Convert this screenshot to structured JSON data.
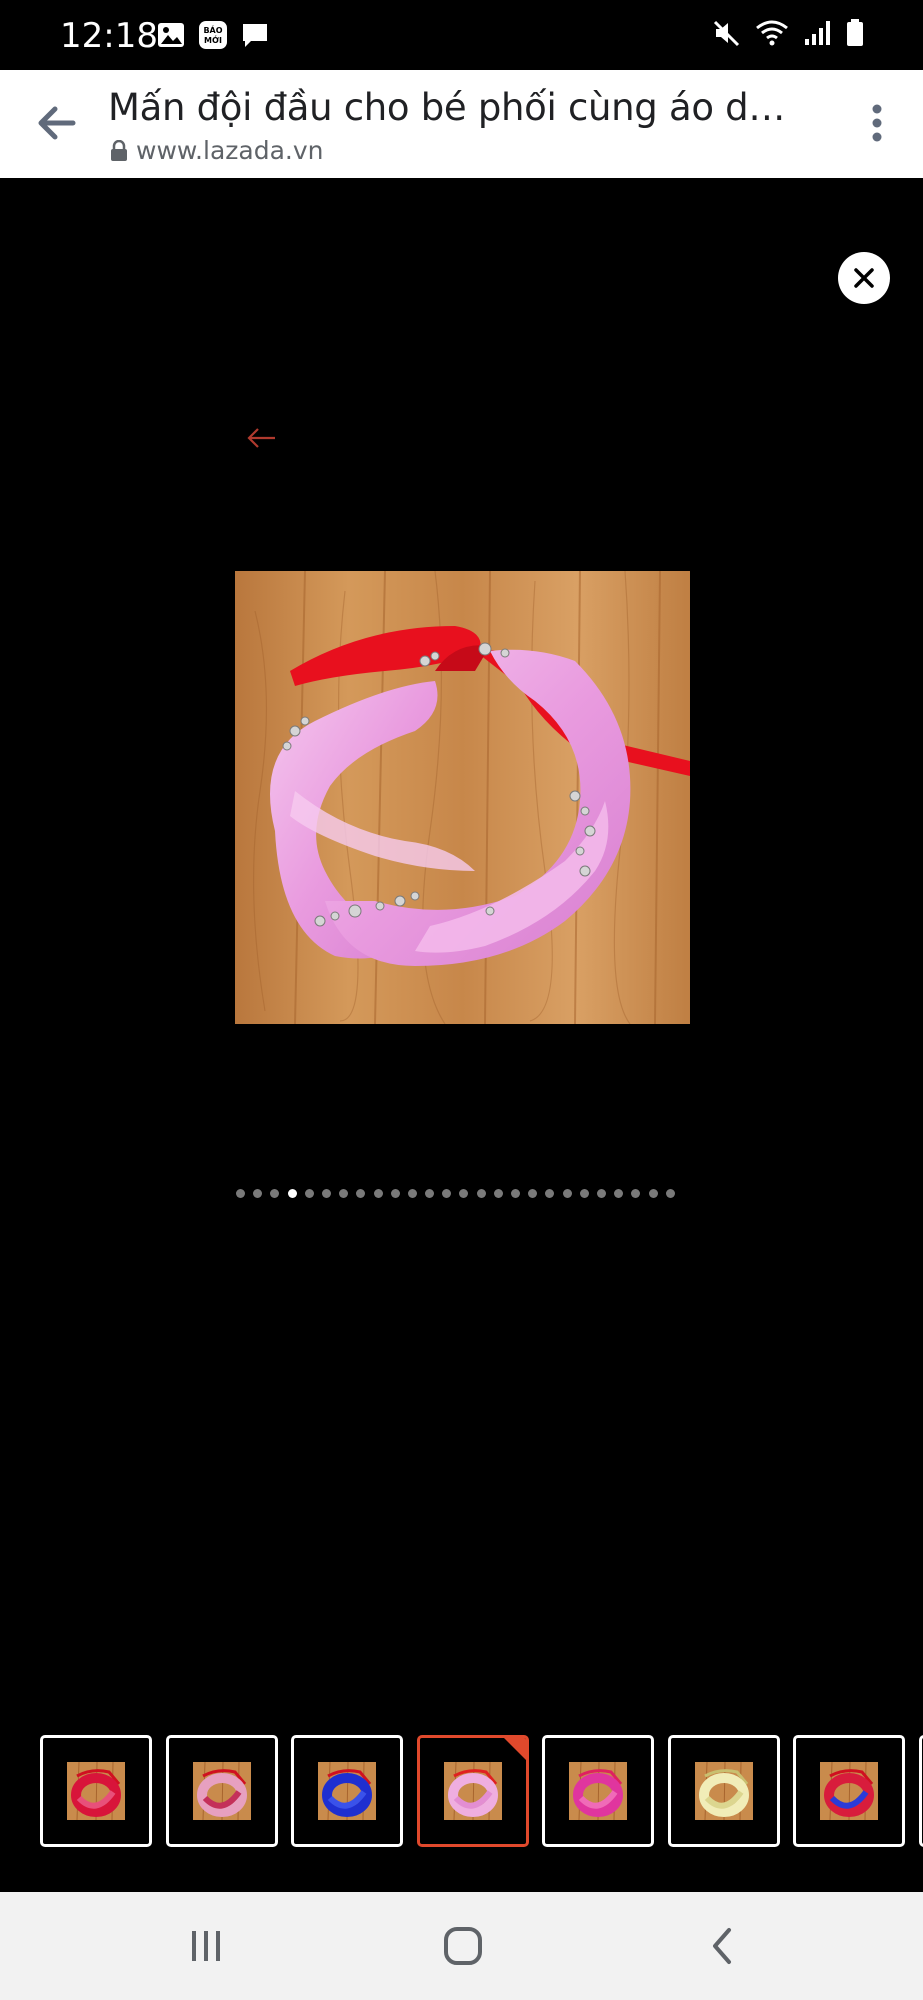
{
  "status_bar": {
    "time": "12:18",
    "left_icons": [
      "image-icon",
      "bao-moi-icon",
      "message-icon"
    ],
    "bao_moi_label": "BÁO MỚI",
    "right_icons": [
      "mute-icon",
      "wifi-icon",
      "signal-icon",
      "battery-icon"
    ]
  },
  "browser": {
    "title": "Mấn đội đầu cho bé phối cùng áo dài...",
    "url": "www.lazada.vn"
  },
  "viewer": {
    "dot_count": 26,
    "active_dot": 3,
    "thumbnails": [
      {
        "name": "thumb-red",
        "colors": [
          "#d8143a",
          "#e8507a"
        ],
        "ribbon": "#d01020"
      },
      {
        "name": "thumb-pink-striped",
        "colors": [
          "#e7a0c0",
          "#c4305a"
        ],
        "ribbon": "#d01020"
      },
      {
        "name": "thumb-blue",
        "colors": [
          "#1f2fd0",
          "#3a52ea"
        ],
        "ribbon": "#d01020"
      },
      {
        "name": "thumb-light-pink",
        "colors": [
          "#efaee0",
          "#e38ed2"
        ],
        "ribbon": "#e02020"
      },
      {
        "name": "thumb-magenta",
        "colors": [
          "#e0359e",
          "#f06bb8"
        ],
        "ribbon": "#e02060"
      },
      {
        "name": "thumb-cream",
        "colors": [
          "#f1edb8",
          "#dcd68f"
        ],
        "ribbon": "#c9c070"
      },
      {
        "name": "thumb-red-blue",
        "colors": [
          "#d81c3c",
          "#2a3bd8"
        ],
        "ribbon": "#d01020"
      }
    ],
    "active_thumbnail": 3
  },
  "colors": {
    "accent": "#e0492c",
    "main_product": "#eaa4e2",
    "ribbon": "#e8101e",
    "floor": "#c98b4c"
  }
}
